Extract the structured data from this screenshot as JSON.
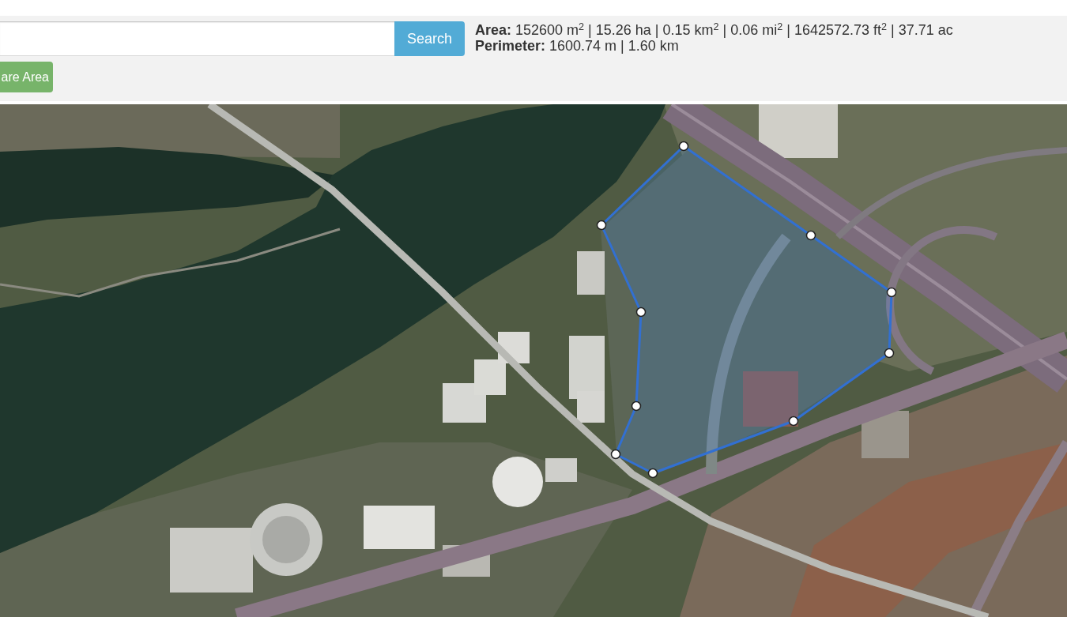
{
  "search": {
    "button": "Search"
  },
  "action_button": "are Area",
  "results": {
    "area": "**Area:** 152600 m$^{2}$ | 15.26 ha | 0.15 km$^{2}$ | 0.06 mi$^{2}$ | 1642572.73 ft$^{2}$ | 37.71 ac",
    "perimeter": "**Perimeter:** 1600.74 m | 1.60 km"
  },
  "map": {
    "kind": "satellite",
    "overlay": {
      "kind": "polygon"
    }
  }
}
